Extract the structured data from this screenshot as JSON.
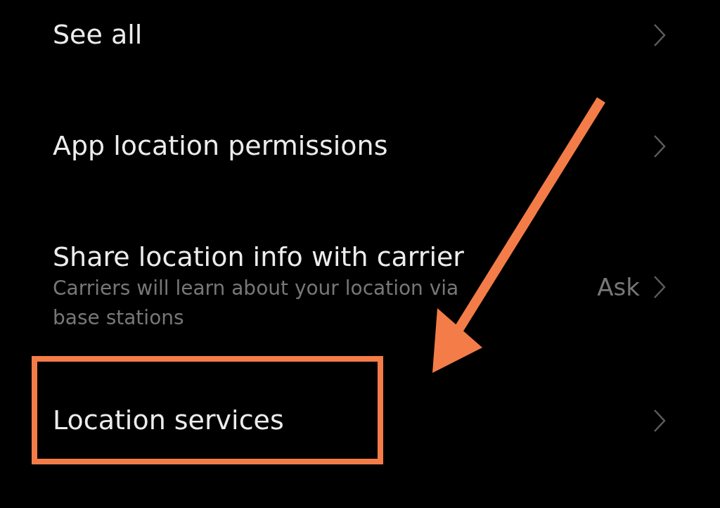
{
  "settings_list": [
    {
      "title": "See all",
      "highlighted": false
    },
    {
      "title": "App location permissions",
      "highlighted": false
    },
    {
      "title": "Share location info with carrier",
      "subtitle": "Carriers will learn about your location via base stations",
      "value": "Ask",
      "highlighted": false
    },
    {
      "title": "Location services",
      "highlighted": true
    }
  ]
}
